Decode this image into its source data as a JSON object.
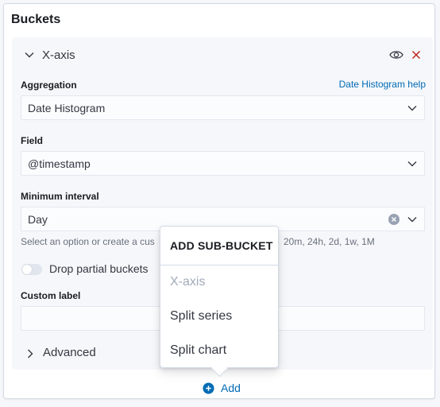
{
  "panel": {
    "title": "Buckets"
  },
  "accordion": {
    "title": "X-axis",
    "aggregation": {
      "label": "Aggregation",
      "help_link": "Date Histogram help",
      "value": "Date Histogram"
    },
    "field": {
      "label": "Field",
      "value": "@timestamp"
    },
    "min_interval": {
      "label": "Minimum interval",
      "value": "Day",
      "help_text_start": "Select an option or create a cus",
      "help_text_end": "20m, 24h, 2d, 1w, 1M"
    },
    "drop_partial": {
      "label": "Drop partial buckets",
      "checked": false
    },
    "custom_label": {
      "label": "Custom label",
      "value": ""
    },
    "advanced": {
      "label": "Advanced"
    }
  },
  "popover": {
    "title": "ADD SUB-BUCKET",
    "items": [
      {
        "label": "X-axis",
        "disabled": true
      },
      {
        "label": "Split series",
        "disabled": false
      },
      {
        "label": "Split chart",
        "disabled": false
      }
    ]
  },
  "add_button": {
    "label": "Add"
  },
  "colors": {
    "link": "#006bb4",
    "danger": "#bd271e",
    "text": "#343741",
    "muted": "#69707d",
    "disabled": "#a2abba"
  },
  "icons": [
    "chevron-down-icon",
    "eye-icon",
    "cross-icon",
    "clear-icon",
    "chevron-right-icon",
    "plus-circle-icon"
  ]
}
